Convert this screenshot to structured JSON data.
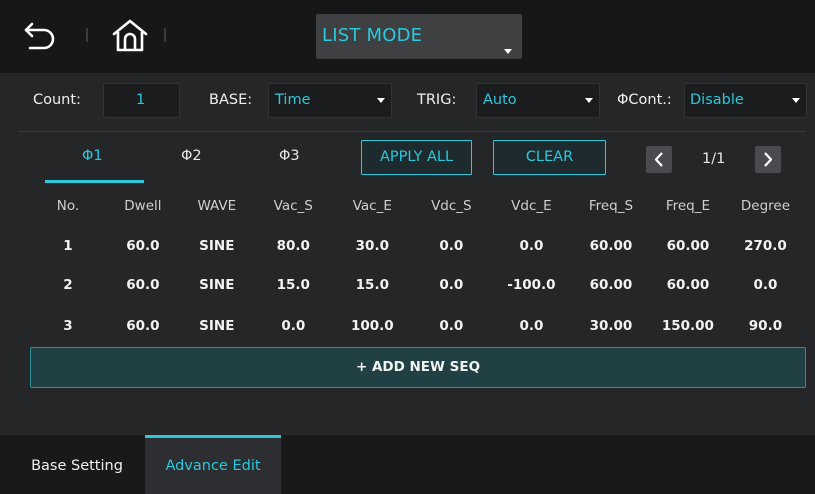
{
  "header": {
    "mode_value": "LIST MODE",
    "back_icon": "back-arrow-icon",
    "home_icon": "home-icon"
  },
  "settings": {
    "count_label": "Count:",
    "count_value": "1",
    "base_label": "BASE:",
    "base_value": "Time",
    "trig_label": "TRIG:",
    "trig_value": "Auto",
    "cont_label": "ΦCont.:",
    "cont_value": "Disable"
  },
  "tabs": [
    "Φ1",
    "Φ2",
    "Φ3"
  ],
  "actions": {
    "apply_all": "APPLY ALL",
    "clear": "CLEAR"
  },
  "pager": {
    "page": "1/1"
  },
  "table": {
    "headers": [
      "No.",
      "Dwell",
      "WAVE",
      "Vac_S",
      "Vac_E",
      "Vdc_S",
      "Vdc_E",
      "Freq_S",
      "Freq_E",
      "Degree"
    ],
    "rows": [
      [
        "1",
        "60.0",
        "SINE",
        "80.0",
        "30.0",
        "0.0",
        "0.0",
        "60.00",
        "60.00",
        "270.0"
      ],
      [
        "2",
        "60.0",
        "SINE",
        "15.0",
        "15.0",
        "0.0",
        "-100.0",
        "60.00",
        "60.00",
        "0.0"
      ],
      [
        "3",
        "60.0",
        "SINE",
        "0.0",
        "100.0",
        "0.0",
        "0.0",
        "30.00",
        "150.00",
        "90.0"
      ]
    ]
  },
  "add_seq_label": "+ ADD NEW SEQ",
  "bottom_tabs": {
    "base_setting": "Base Setting",
    "advance_edit": "Advance Edit"
  },
  "colors": {
    "accent": "#2cc8dc",
    "background": "#252628"
  }
}
